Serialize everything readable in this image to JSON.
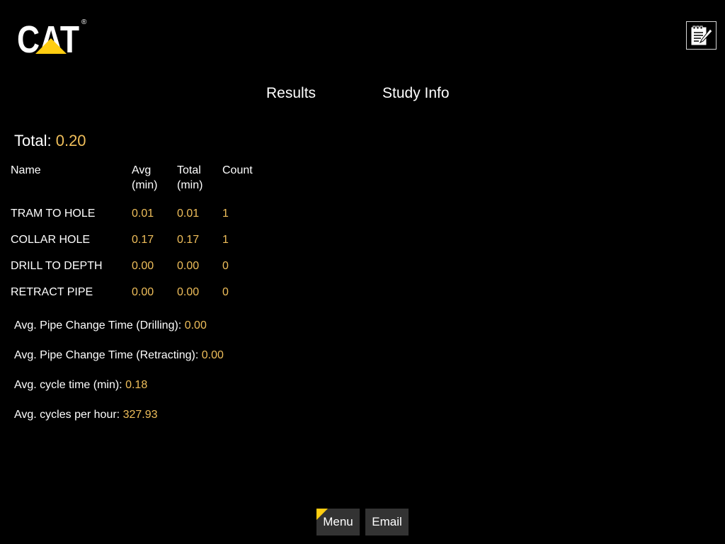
{
  "header": {
    "logo_text": "CAT",
    "logo_mark": "®"
  },
  "tabs": [
    {
      "label": "Results",
      "active": true
    },
    {
      "label": "Study Info",
      "active": false
    }
  ],
  "total": {
    "label": "Total:",
    "value": "0.20"
  },
  "table": {
    "headers": {
      "name": "Name",
      "avg_line1": "Avg",
      "avg_line2": "(min)",
      "total_line1": "Total",
      "total_line2": "(min)",
      "count": "Count"
    },
    "rows": [
      {
        "name": "TRAM TO HOLE",
        "avg": "0.01",
        "total": "0.01",
        "count": "1"
      },
      {
        "name": "COLLAR HOLE",
        "avg": "0.17",
        "total": "0.17",
        "count": "1"
      },
      {
        "name": "DRILL TO DEPTH",
        "avg": "0.00",
        "total": "0.00",
        "count": "0"
      },
      {
        "name": "RETRACT PIPE",
        "avg": "0.00",
        "total": "0.00",
        "count": "0"
      }
    ]
  },
  "stats": [
    {
      "label": "Avg. Pipe Change Time (Drilling):",
      "value": "0.00"
    },
    {
      "label": "Avg. Pipe Change Time (Retracting):",
      "value": "0.00"
    },
    {
      "label": "Avg. cycle time (min):",
      "value": "0.18"
    },
    {
      "label": "Avg. cycles per hour:",
      "value": "327.93"
    }
  ],
  "footer": {
    "menu_label": "Menu",
    "email_label": "Email"
  },
  "colors": {
    "value": "#f0bf5b",
    "brand_yellow": "#ffcd11",
    "background": "#000000",
    "button_bg": "#333333"
  },
  "icons": {
    "edit": "notepad-pencil-icon"
  }
}
